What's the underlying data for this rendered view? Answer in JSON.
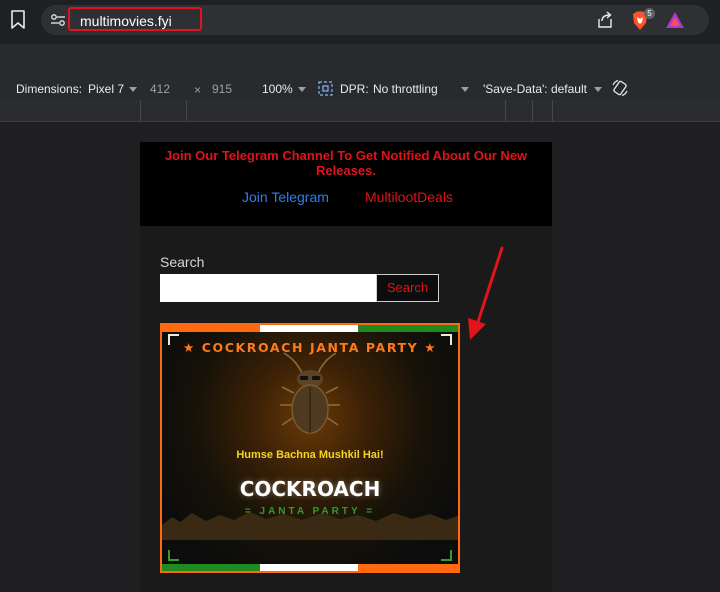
{
  "browser": {
    "url": "multimovies.fyi",
    "shield_count": "5"
  },
  "devtools": {
    "dimensions_label": "Dimensions:",
    "device": "Pixel 7",
    "width": "412",
    "times": "×",
    "height": "915",
    "zoom": "100%",
    "dpr_label": "DPR:",
    "throttling": "No throttling",
    "save_data": "'Save-Data': default"
  },
  "page": {
    "telegram_notice": "Join Our Telegram Channel To Get Notified About Our New Releases.",
    "join_telegram": "Join Telegram",
    "multiloot": "MultilootDeals",
    "search_label": "Search",
    "search_placeholder": "",
    "search_button": "Search"
  },
  "banner": {
    "title": "★ COCKROACH JANTA PARTY ★",
    "tagline": "Humse Bachna Mushkil Hai!",
    "headline": "COCKROACH",
    "subline": "= JANTA PARTY =",
    "colors": {
      "saffron": "#ff6a10",
      "white": "#ffffff",
      "green": "#1f8a1f"
    }
  },
  "annotation": {
    "arrow_color": "#e0141a"
  }
}
